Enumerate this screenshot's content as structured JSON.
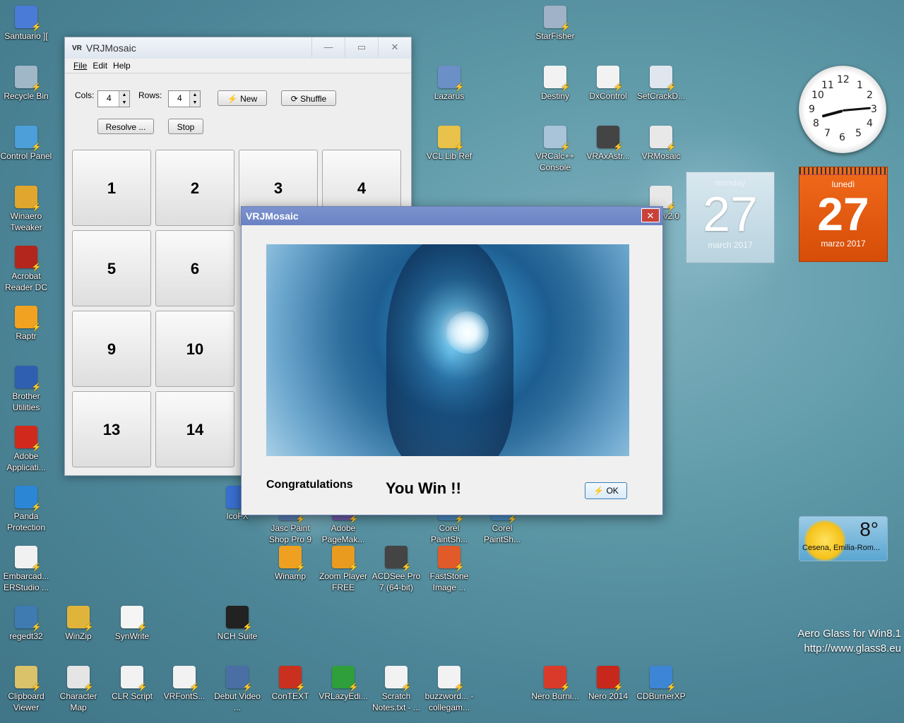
{
  "desktop": {
    "icons": [
      {
        "label": "Santuario ][",
        "color": "#4a7bd6"
      },
      {
        "label": "Recycle Bin",
        "color": "#9fb7c7"
      },
      {
        "label": "Control Panel",
        "color": "#4c9fd8"
      },
      {
        "label": "Winaero Tweaker",
        "color": "#e1a62e"
      },
      {
        "label": "Acrobat Reader DC",
        "color": "#b3261e"
      },
      {
        "label": "Raptr",
        "color": "#f2a221"
      },
      {
        "label": "Brother Utilities",
        "color": "#2e5fb1"
      },
      {
        "label": "Adobe Applicati...",
        "color": "#d12a1c"
      },
      {
        "label": "Panda Protection",
        "color": "#2c86d6"
      },
      {
        "label": "Embarcad... ERStudio ...",
        "color": "#f1f1f1"
      },
      {
        "label": "regedt32",
        "color": "#3f7ab1"
      },
      {
        "label": "WinZip",
        "color": "#e0b43a"
      },
      {
        "label": "SynWrite",
        "color": "#f5f5f5"
      },
      {
        "label": "NCH Suite",
        "color": "#222222"
      },
      {
        "label": "Clipboard Viewer",
        "color": "#d9c26a"
      },
      {
        "label": "Character Map",
        "color": "#e5e5e5"
      },
      {
        "label": "CLR Script",
        "color": "#f2f2f2"
      },
      {
        "label": "VRFontS...",
        "color": "#f2f2f2"
      },
      {
        "label": "Debut Video ...",
        "color": "#4a6fa5"
      },
      {
        "label": "ConTEXT",
        "color": "#c9301f"
      },
      {
        "label": "VRLazyEdi...",
        "color": "#2e9f3b"
      },
      {
        "label": "Scratch Notes.txt - ...",
        "color": "#f2f2f2"
      },
      {
        "label": "buzzword... - collegam...",
        "color": "#f2f2f2"
      },
      {
        "label": "Nero Burni...",
        "color": "#d93b2b"
      },
      {
        "label": "Nero 2014",
        "color": "#c8281b"
      },
      {
        "label": "CDBurnerXP",
        "color": "#3d86d6"
      },
      {
        "label": "StarFisher",
        "color": "#9fb2c7"
      },
      {
        "label": "Lazarus",
        "color": "#6b8fc7"
      },
      {
        "label": "Destiny",
        "color": "#f2f2f2"
      },
      {
        "label": "DxControl",
        "color": "#f2f2f2"
      },
      {
        "label": "SetCrackD...",
        "color": "#dfe6ee"
      },
      {
        "label": "VCL Lib Ref",
        "color": "#e8c24a"
      },
      {
        "label": "VRCalc++ Console",
        "color": "#a9c3d9"
      },
      {
        "label": "VRAxAstr...",
        "color": "#444444"
      },
      {
        "label": "VRMosaic",
        "color": "#e8e8e8"
      },
      {
        "label": "AWT v2.0",
        "color": "#e8e8e8"
      },
      {
        "label": "IcoFX",
        "color": "#3a6fd0"
      },
      {
        "label": "Jasc Paint Shop Pro 9",
        "color": "#5a7fb5"
      },
      {
        "label": "Adobe PageMak...",
        "color": "#6d5aa5"
      },
      {
        "label": "Corel PaintSh...",
        "color": "#4b8ac0"
      },
      {
        "label": "Corel PaintSh...",
        "color": "#4b8ac0"
      },
      {
        "label": "Winamp",
        "color": "#f0a020"
      },
      {
        "label": "Zoom Player FREE",
        "color": "#e89b1e"
      },
      {
        "label": "ACDSee Pro 7 (64-bit)",
        "color": "#444444"
      },
      {
        "label": "FastStone Image ...",
        "color": "#e05a2a"
      }
    ]
  },
  "app": {
    "logo": "VR",
    "title": "VRJMosaic",
    "controls": {
      "minimize": "—",
      "maximize": "▭",
      "close": "✕"
    },
    "menu": [
      "File",
      "Edit",
      "Help"
    ],
    "cols_label": "Cols:",
    "cols_value": "4",
    "rows_label": "Rows:",
    "rows_value": "4",
    "new_label": "New",
    "shuffle_label": "Shuffle",
    "resolve_label": "Resolve ...",
    "stop_label": "Stop",
    "tiles": [
      "1",
      "2",
      "3",
      "4",
      "5",
      "6",
      "9",
      "10",
      "13",
      "14"
    ]
  },
  "dialog": {
    "title": "VRJMosaic",
    "close": "✕",
    "congrats": "Congratulations",
    "message": "You Win !!",
    "ok_label": "OK"
  },
  "gadgets": {
    "clock": {
      "numbers": [
        "12",
        "1",
        "2",
        "3",
        "4",
        "5",
        "6",
        "7",
        "8",
        "9",
        "10",
        "11"
      ]
    },
    "calendar1": {
      "day": "monday",
      "date": "27",
      "month": "march 2017"
    },
    "calendar2": {
      "day": "lunedì",
      "date": "27",
      "month": "marzo 2017"
    },
    "weather": {
      "temp": "8°",
      "location": "Cesena, Emilia-Rom..."
    },
    "aero_line1": "Aero Glass for Win8.1",
    "aero_line2": "http://www.glass8.eu"
  }
}
